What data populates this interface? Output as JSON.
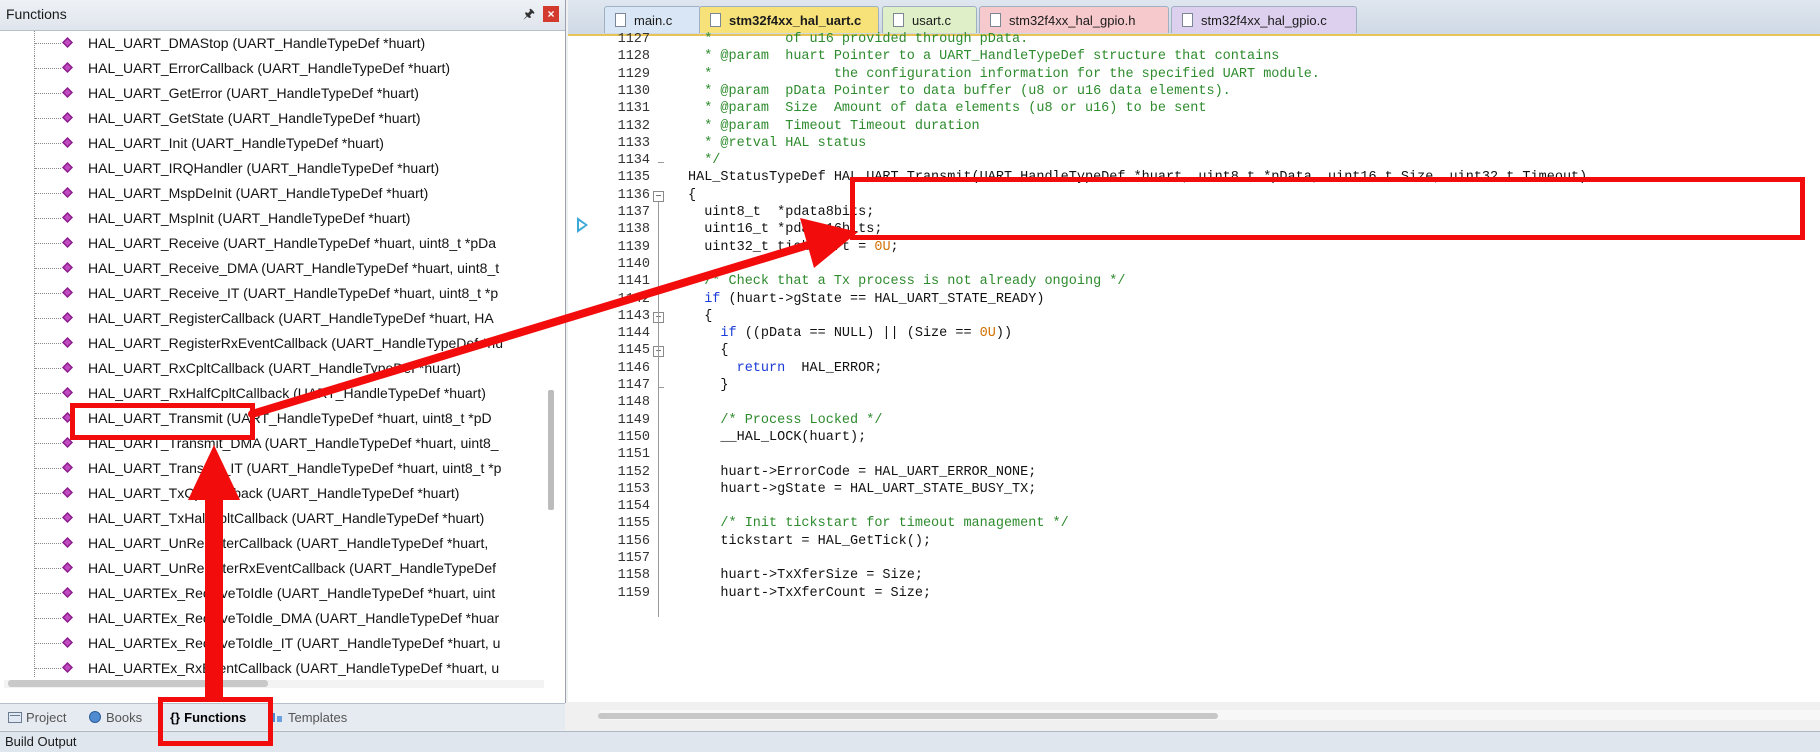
{
  "functions_panel": {
    "title": "Functions",
    "pin_icon": "pin-icon",
    "close_icon": "close-icon",
    "items": [
      "HAL_UART_DMAStop (UART_HandleTypeDef *huart)",
      "HAL_UART_ErrorCallback (UART_HandleTypeDef *huart)",
      "HAL_UART_GetError (UART_HandleTypeDef *huart)",
      "HAL_UART_GetState (UART_HandleTypeDef *huart)",
      "HAL_UART_Init (UART_HandleTypeDef *huart)",
      "HAL_UART_IRQHandler (UART_HandleTypeDef *huart)",
      "HAL_UART_MspDeInit (UART_HandleTypeDef *huart)",
      "HAL_UART_MspInit (UART_HandleTypeDef *huart)",
      "HAL_UART_Receive (UART_HandleTypeDef *huart, uint8_t *pDa",
      "HAL_UART_Receive_DMA (UART_HandleTypeDef *huart, uint8_t",
      "HAL_UART_Receive_IT (UART_HandleTypeDef *huart, uint8_t *p",
      "HAL_UART_RegisterCallback (UART_HandleTypeDef *huart, HA",
      "HAL_UART_RegisterRxEventCallback (UART_HandleTypeDef *hu",
      "HAL_UART_RxCpltCallback (UART_HandleTypeDef *huart)",
      "HAL_UART_RxHalfCpltCallback (UART_HandleTypeDef *huart)",
      "HAL_UART_Transmit (UART_HandleTypeDef *huart, uint8_t *pD",
      "HAL_UART_Transmit_DMA (UART_HandleTypeDef *huart, uint8_",
      "HAL_UART_Transmit_IT (UART_HandleTypeDef *huart, uint8_t *p",
      "HAL_UART_TxCpltCallback (UART_HandleTypeDef *huart)",
      "HAL_UART_TxHalfCpltCallback (UART_HandleTypeDef *huart)",
      "HAL_UART_UnRegisterCallback (UART_HandleTypeDef *huart,",
      "HAL_UART_UnRegisterRxEventCallback (UART_HandleTypeDef",
      "HAL_UARTEx_ReceiveToIdle (UART_HandleTypeDef *huart, uint",
      "HAL_UARTEx_ReceiveToIdle_DMA (UART_HandleTypeDef *huar",
      "HAL_UARTEx_ReceiveToIdle_IT (UART_HandleTypeDef *huart, u",
      "HAL_UARTEx_RxEventCallback (UART_HandleTypeDef *huart, u"
    ],
    "bullet_color": "#8b1a8b"
  },
  "panel_tabs": [
    {
      "label": "Project",
      "icon": "project-icon"
    },
    {
      "label": "Books",
      "icon": "books-icon"
    },
    {
      "label": "Functions",
      "icon": "functions-icon",
      "active": true
    },
    {
      "label": "Templates",
      "icon": "templates-icon"
    }
  ],
  "build_output": {
    "label": "Build Output"
  },
  "editor_tabs": [
    {
      "label": "main.c",
      "color": "#d9e6f5"
    },
    {
      "label": "stm32f4xx_hal_uart.c",
      "color": "#f7e27a",
      "active": true
    },
    {
      "label": "usart.c",
      "color": "#dff0c8"
    },
    {
      "label": "stm32f4xx_hal_gpio.h",
      "color": "#f6c9cc"
    },
    {
      "label": "stm32f4xx_hal_gpio.c",
      "color": "#dcd0ee"
    }
  ],
  "code_lines": [
    {
      "n": "1127",
      "html": "<span class=\"cmt\">  *         of u16 provided through pData.</span>"
    },
    {
      "n": "1128",
      "html": "<span class=\"cmt\">  * @param  huart Pointer to a UART_HandleTypeDef structure that contains</span>"
    },
    {
      "n": "1129",
      "html": "<span class=\"cmt\">  *               the configuration information for the specified UART module.</span>"
    },
    {
      "n": "1130",
      "html": "<span class=\"cmt\">  * @param  pData Pointer to data buffer (u8 or u16 data elements).</span>"
    },
    {
      "n": "1131",
      "html": "<span class=\"cmt\">  * @param  Size  Amount of data elements (u8 or u16) to be sent</span>"
    },
    {
      "n": "1132",
      "html": "<span class=\"cmt\">  * @param  Timeout Timeout duration</span>"
    },
    {
      "n": "1133",
      "html": "<span class=\"cmt\">  * @retval HAL status</span>"
    },
    {
      "n": "1134",
      "html": "<span class=\"cmt\">  */</span>"
    },
    {
      "n": "1135",
      "html": "HAL_StatusTypeDef HAL_UART_Transmit(UART_HandleTypeDef *huart, uint8_t *pData, uint16_t Size, uint32_t Timeout)"
    },
    {
      "n": "1136",
      "html": "{"
    },
    {
      "n": "1137",
      "html": "  uint8_t  *pdata8bits;"
    },
    {
      "n": "1138",
      "html": "  uint16_t *pdata16bits;"
    },
    {
      "n": "1139",
      "html": "  uint32_t tickstart = <span class=\"num\">0U</span>;"
    },
    {
      "n": "1140",
      "html": ""
    },
    {
      "n": "1141",
      "html": "<span class=\"cmt\">  /* Check that a Tx process is not already ongoing */</span>"
    },
    {
      "n": "1142",
      "html": "  <span class=\"kw\">if</span> (huart-&gt;gState == HAL_UART_STATE_READY)"
    },
    {
      "n": "1143",
      "html": "  {"
    },
    {
      "n": "1144",
      "html": "    <span class=\"kw\">if</span> ((pData == NULL) || (Size == <span class=\"num\">0U</span>))"
    },
    {
      "n": "1145",
      "html": "    {"
    },
    {
      "n": "1146",
      "html": "      <span class=\"kw\">return</span>  HAL_ERROR;"
    },
    {
      "n": "1147",
      "html": "    }"
    },
    {
      "n": "1148",
      "html": ""
    },
    {
      "n": "1149",
      "html": "<span class=\"cmt\">    /* Process Locked */</span>"
    },
    {
      "n": "1150",
      "html": "    __HAL_LOCK(huart);"
    },
    {
      "n": "1151",
      "html": ""
    },
    {
      "n": "1152",
      "html": "    huart-&gt;ErrorCode = HAL_UART_ERROR_NONE;"
    },
    {
      "n": "1153",
      "html": "    huart-&gt;gState = HAL_UART_STATE_BUSY_TX;"
    },
    {
      "n": "1154",
      "html": ""
    },
    {
      "n": "1155",
      "html": "<span class=\"cmt\">    /* Init tickstart for timeout management */</span>"
    },
    {
      "n": "1156",
      "html": "    tickstart = HAL_GetTick();"
    },
    {
      "n": "1157",
      "html": ""
    },
    {
      "n": "1158",
      "html": "    huart-&gt;TxXferSize = Size;"
    },
    {
      "n": "1159",
      "html": "    huart-&gt;TxXferCount = Size;"
    }
  ],
  "annotation_color": "#f30c0c"
}
